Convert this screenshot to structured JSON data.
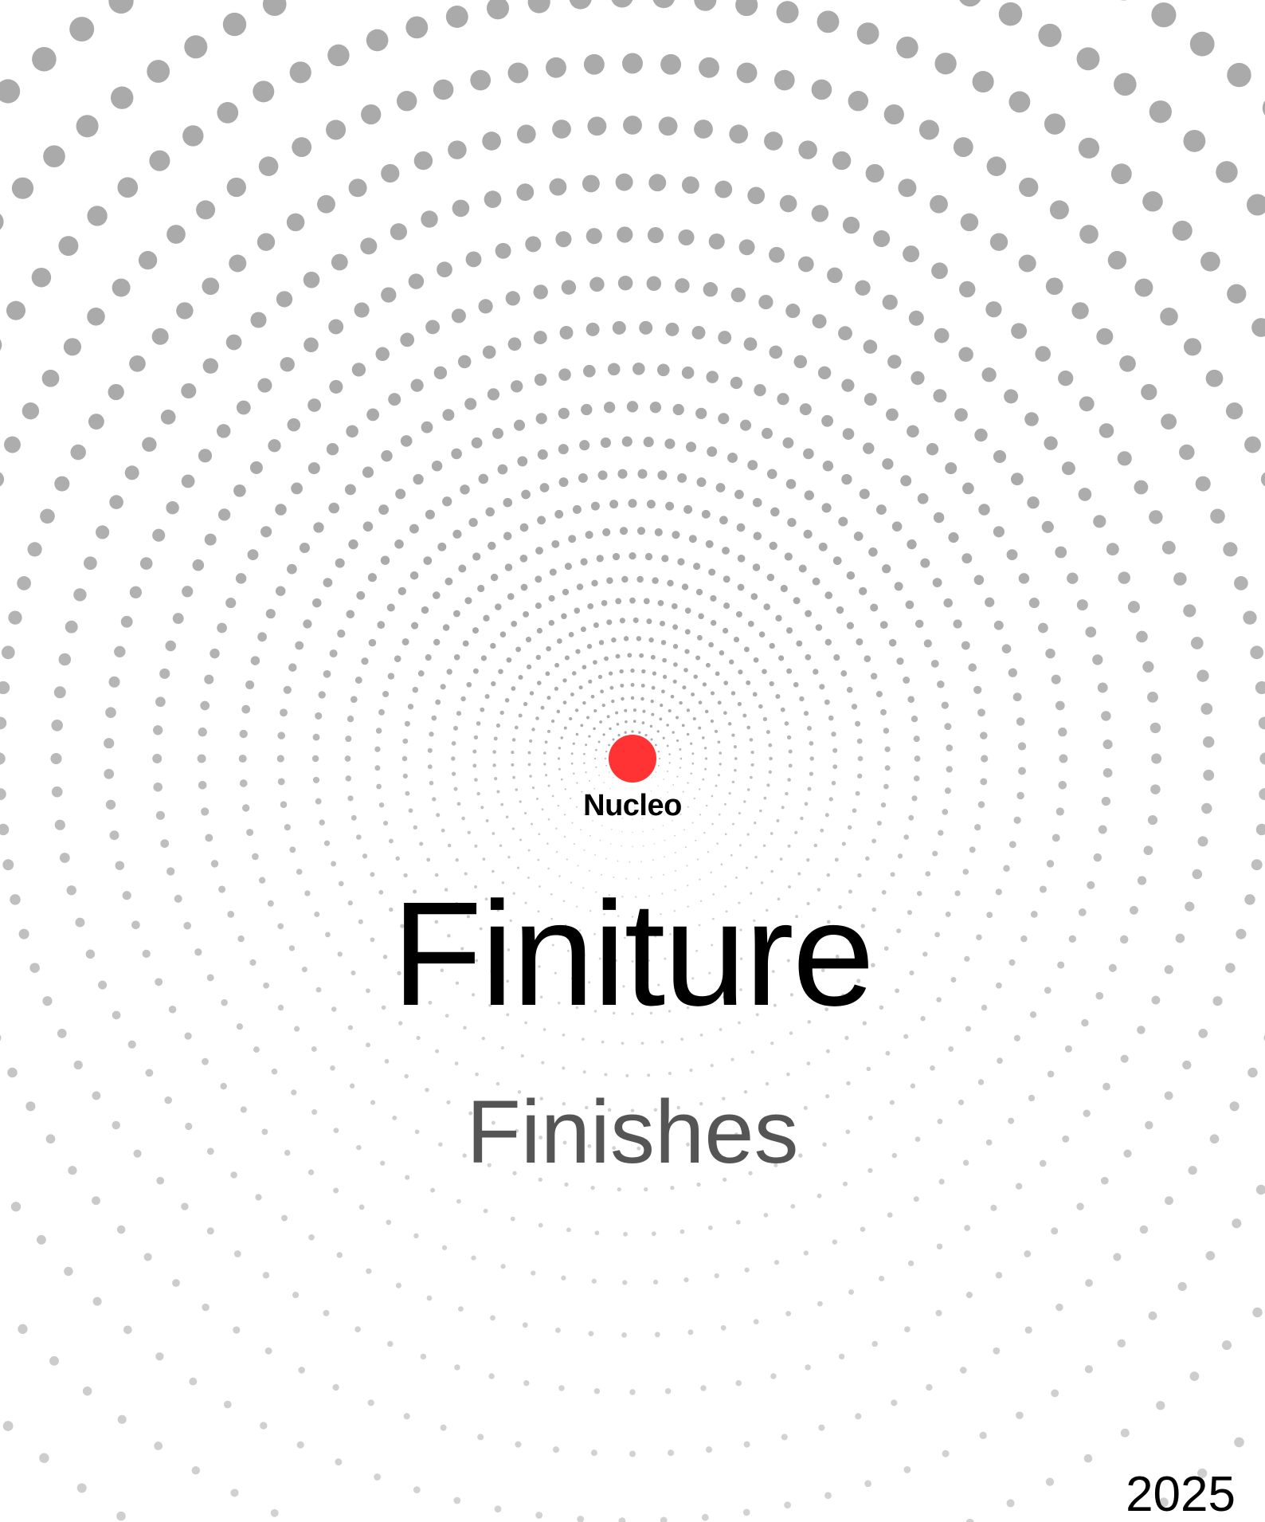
{
  "brand": {
    "name": "Nucleo",
    "dot_color": "#ff3333"
  },
  "cover": {
    "title": "Finiture",
    "subtitle": "Finishes",
    "year": "2025"
  },
  "pattern": {
    "dot_color": "#aaaaaa",
    "style": "radial dot halftone, larger dots toward top, fading toward bottom"
  }
}
